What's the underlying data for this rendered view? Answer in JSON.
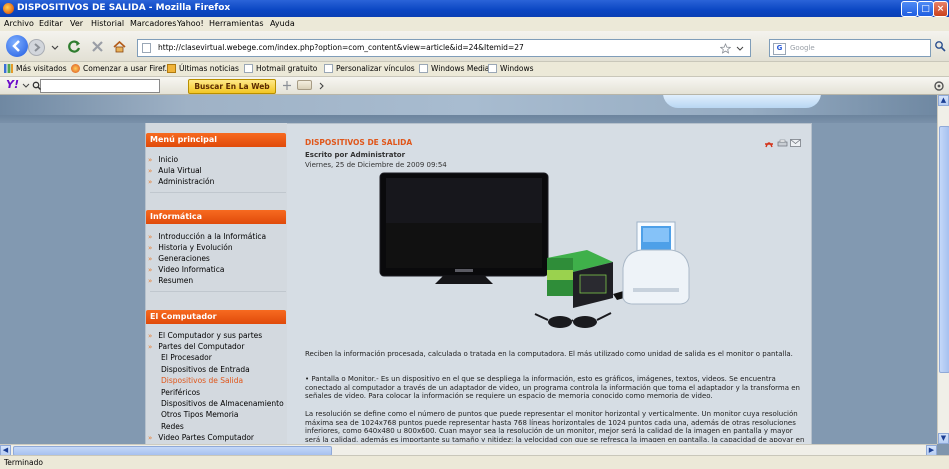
{
  "window": {
    "title": "DISPOSITIVOS DE SALIDA - Mozilla Firefox",
    "controls": [
      "minimize",
      "maximize",
      "close"
    ]
  },
  "menubar": [
    "Archivo",
    "Editar",
    "Ver",
    "Historial",
    "Marcadores",
    "Yahoo!",
    "Herramientas",
    "Ayuda"
  ],
  "navigation": {
    "url": "http://clasevirtual.webege.com/index.php?option=com_content&view=article&id=24&Itemid=27",
    "search_placeholder": "Google"
  },
  "bookmarks": [
    {
      "label": "Más visitados",
      "icon": "bar-chart-icon"
    },
    {
      "label": "Comenzar a usar Firef...",
      "icon": "firefox-icon"
    },
    {
      "label": "Últimas noticias",
      "icon": "rss-icon"
    },
    {
      "label": "Hotmail gratuito",
      "icon": "page-icon"
    },
    {
      "label": "Personalizar vínculos",
      "icon": "page-icon"
    },
    {
      "label": "Windows Media",
      "icon": "page-icon"
    },
    {
      "label": "Windows",
      "icon": "page-icon"
    }
  ],
  "yahoo_toolbar": {
    "logo": "Y!",
    "search_button": "Buscar En La Web"
  },
  "sidebar": {
    "menu_principal": {
      "title": "Menú principal",
      "items": [
        "Inicio",
        "Aula Virtual",
        "Administración"
      ]
    },
    "informatica": {
      "title": "Informática",
      "items": [
        "Introducción a la Informática",
        "Historia y Evolución",
        "Generaciones",
        "Video Informatica",
        "Resumen"
      ]
    },
    "computador": {
      "title": "El Computador",
      "items": [
        "El Computador y sus partes",
        "Partes del Computador"
      ],
      "subitems": [
        "El Procesador",
        "Dispositivos de Entrada",
        "Dispositivos de Salida",
        "Periféricos",
        "Dispositivos de Almacenamiento",
        "Otros Tipos Memoria",
        "Redes"
      ],
      "last_item": "Video Partes Computador",
      "active_subitem": "Dispositivos de Salida"
    }
  },
  "article": {
    "title": "DISPOSITIVOS DE SALIDA",
    "author": "Escrito por Administrator",
    "date": "Viernes, 25 de Diciembre de 2009 09:54",
    "intro": "Reciben la información procesada, calculada o tratada en la computadora. El más utilizado como unidad de salida es el monitor o pantalla.",
    "body1": "• Pantalla o Monitor.- Es un dispositivo en el que se despliega la información, esto es gráficos, imágenes, textos, videos. Se encuentra conectado al computador a través de un adaptador de video, un programa controla la información que toma el adaptador y la transforma en señales de video. Para colocar la información se requiere un espacio de memoria conocido como memoria de video.",
    "body2": "La resolución se define como el número de puntos que puede representar el monitor horizontal y verticalmente. Un monitor cuya resolución máxima sea de 1024x768 puntos puede representar hasta 768 líneas horizontales de 1024 puntos cada una, además de otras resoluciones inferiores, como 640x480 u 800x600. Cuan mayor sea la resolución de un monitor, mejor será la calidad de la imagen en pantalla y mayor será la calidad, además es importante su tamaño y nitidez; la velocidad con que se refresca la imagen en pantalla, la capacidad de apoyar en el trabajo en dos o"
  },
  "status": "Terminado",
  "colors": {
    "accent": "#e04a0a",
    "titlebar": "#0b46c2",
    "page_bg": "#8299b1"
  }
}
